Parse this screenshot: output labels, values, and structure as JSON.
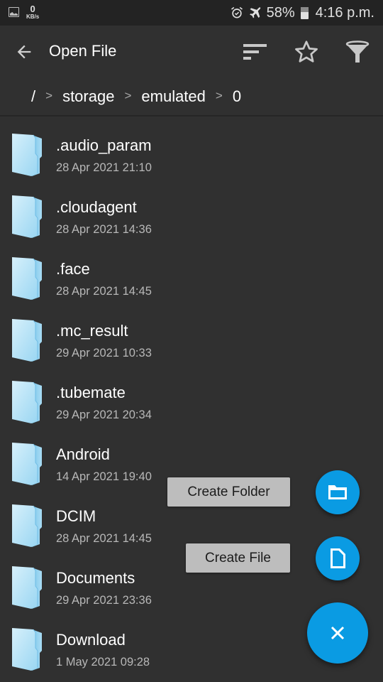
{
  "status_bar": {
    "net_speed_value": "0",
    "net_speed_unit": "KB/s",
    "battery": "58%",
    "time": "4:16 p.m.",
    "icons": [
      "image-notification-icon",
      "alarm-icon",
      "airplane-mode-icon",
      "battery-icon"
    ]
  },
  "toolbar": {
    "title": "Open File",
    "back_icon": "arrow-back-icon",
    "actions": [
      {
        "name": "sort",
        "icon": "sort-icon"
      },
      {
        "name": "favorites",
        "icon": "star-outline-icon"
      },
      {
        "name": "filter",
        "icon": "filter-funnel-icon"
      }
    ]
  },
  "breadcrumb": {
    "root": "/",
    "separator": ">",
    "segments": [
      "storage",
      "emulated",
      "0"
    ]
  },
  "files": [
    {
      "name": ".audio_param",
      "date": "28 Apr 2021 21:10",
      "type": "folder"
    },
    {
      "name": ".cloudagent",
      "date": "28 Apr 2021 14:36",
      "type": "folder"
    },
    {
      "name": ".face",
      "date": "28 Apr 2021 14:45",
      "type": "folder"
    },
    {
      "name": ".mc_result",
      "date": "29 Apr 2021 10:33",
      "type": "folder"
    },
    {
      "name": ".tubemate",
      "date": "29 Apr 2021 20:34",
      "type": "folder"
    },
    {
      "name": "Android",
      "date": "14 Apr 2021 19:40",
      "type": "folder"
    },
    {
      "name": "DCIM",
      "date": "28 Apr 2021 14:45",
      "type": "folder"
    },
    {
      "name": "Documents",
      "date": "29 Apr 2021 23:36",
      "type": "folder"
    },
    {
      "name": "Download",
      "date": "1 May 2021 09:28",
      "type": "folder"
    }
  ],
  "fab_menu": {
    "create_folder_label": "Create Folder",
    "create_file_label": "Create File",
    "close_icon": "close-icon",
    "accent_color": "#0a9be3"
  }
}
